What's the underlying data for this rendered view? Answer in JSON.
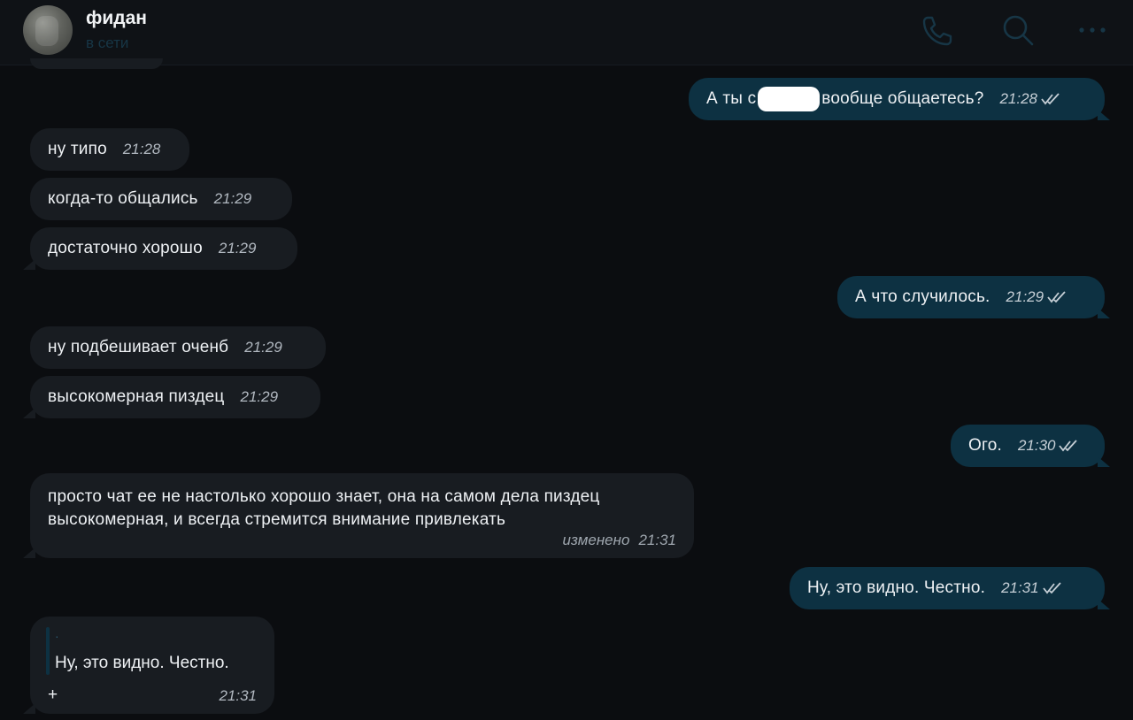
{
  "header": {
    "contact_name": "фидан",
    "status": "в сети",
    "icons": [
      "phone-icon",
      "search-icon",
      "more-icon"
    ]
  },
  "colors": {
    "background": "#0b0d10",
    "incoming_bubble": "#181c21",
    "outgoing_bubble": "#0d3142",
    "status_text": "#173646"
  },
  "messages": [
    {
      "direction": "out",
      "text_before": "А ты с",
      "text_after": "вообще общаетесь?",
      "time": "21:28",
      "read": true
    },
    {
      "direction": "in",
      "text": "ну типо",
      "time": "21:28"
    },
    {
      "direction": "in",
      "text": "когда-то общались",
      "time": "21:29"
    },
    {
      "direction": "in",
      "text": "достаточно хорошо",
      "time": "21:29"
    },
    {
      "direction": "out",
      "text": "А что случилось.",
      "time": "21:29",
      "read": true
    },
    {
      "direction": "in",
      "text": "ну подбешивает оченб",
      "time": "21:29"
    },
    {
      "direction": "in",
      "text": "высокомерная пиздец",
      "time": "21:29"
    },
    {
      "direction": "out",
      "text": "Ого.",
      "time": "21:30",
      "read": true
    },
    {
      "direction": "in",
      "line1": "просто чат ее не настолько хорошо знает, она на самом дела пиздец",
      "line2": "высокомерная, и всегда стремится внимание привлекать",
      "edited_label": "изменено",
      "time": "21:31"
    },
    {
      "direction": "out",
      "text": "Ну, это видно. Честно.",
      "time": "21:31",
      "read": true
    },
    {
      "direction": "in",
      "quote_author": "·",
      "quote_text": "Ну, это видно. Честно.",
      "text": "+",
      "time": "21:31"
    }
  ]
}
